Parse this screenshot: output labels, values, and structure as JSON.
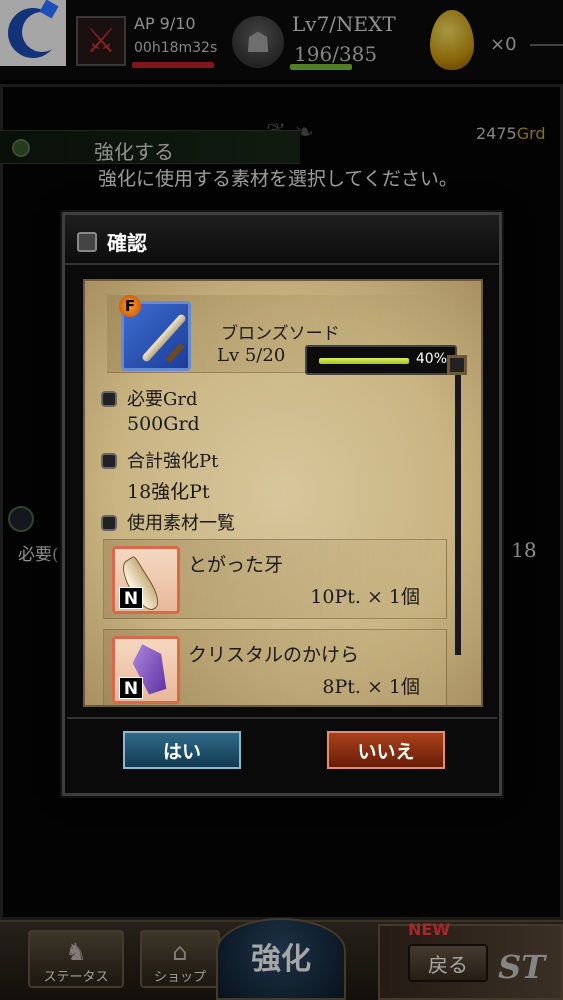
{
  "status": {
    "ap_text": "AP 9/10",
    "ap_timer": "00h18m32s",
    "ap_fraction": 0.9,
    "level_text": "Lv7/NEXT",
    "exp_text": "196/385",
    "exp_fraction": 0.509,
    "egg_count": "×0"
  },
  "background": {
    "grd_amount": "2475",
    "grd_unit": "Grd",
    "title": "強化する",
    "instruction": "強化に使用する素材を選択してください。",
    "left_label": "必要(",
    "right_value": ": 18"
  },
  "modal": {
    "title": "確認",
    "item": {
      "rank": "F",
      "name": "ブロンズソード",
      "level": "Lv 5/20",
      "progress_percent": 40,
      "progress_label": "40%"
    },
    "required_grd_label": "必要Grd",
    "required_grd_value": "500Grd",
    "total_pt_label": "合計強化Pt",
    "total_pt_value": "18強化Pt",
    "materials_label": "使用素材一覧",
    "materials": [
      {
        "rank": "N",
        "name": "とがった牙",
        "qty": "10Pt. × 1個",
        "icon": "fang-icon"
      },
      {
        "rank": "N",
        "name": "クリスタルのかけら",
        "qty": "8Pt. × 1個",
        "icon": "crystal-icon"
      }
    ],
    "yes_label": "はい",
    "no_label": "いいえ"
  },
  "bottom_menu": {
    "status_label": "ステータス",
    "shop_label": "ショップ",
    "enhance_label": "強化",
    "new_badge": "NEW",
    "quest_label": "ST",
    "back_label": "戻る"
  },
  "colors": {
    "ap_bar": "#c8202c",
    "exp_bar": "#7fc238",
    "grd_unit": "#d2a630",
    "yes_button": "#2e6a88",
    "no_button": "#a8421a",
    "parchment": "#d8c79c"
  }
}
